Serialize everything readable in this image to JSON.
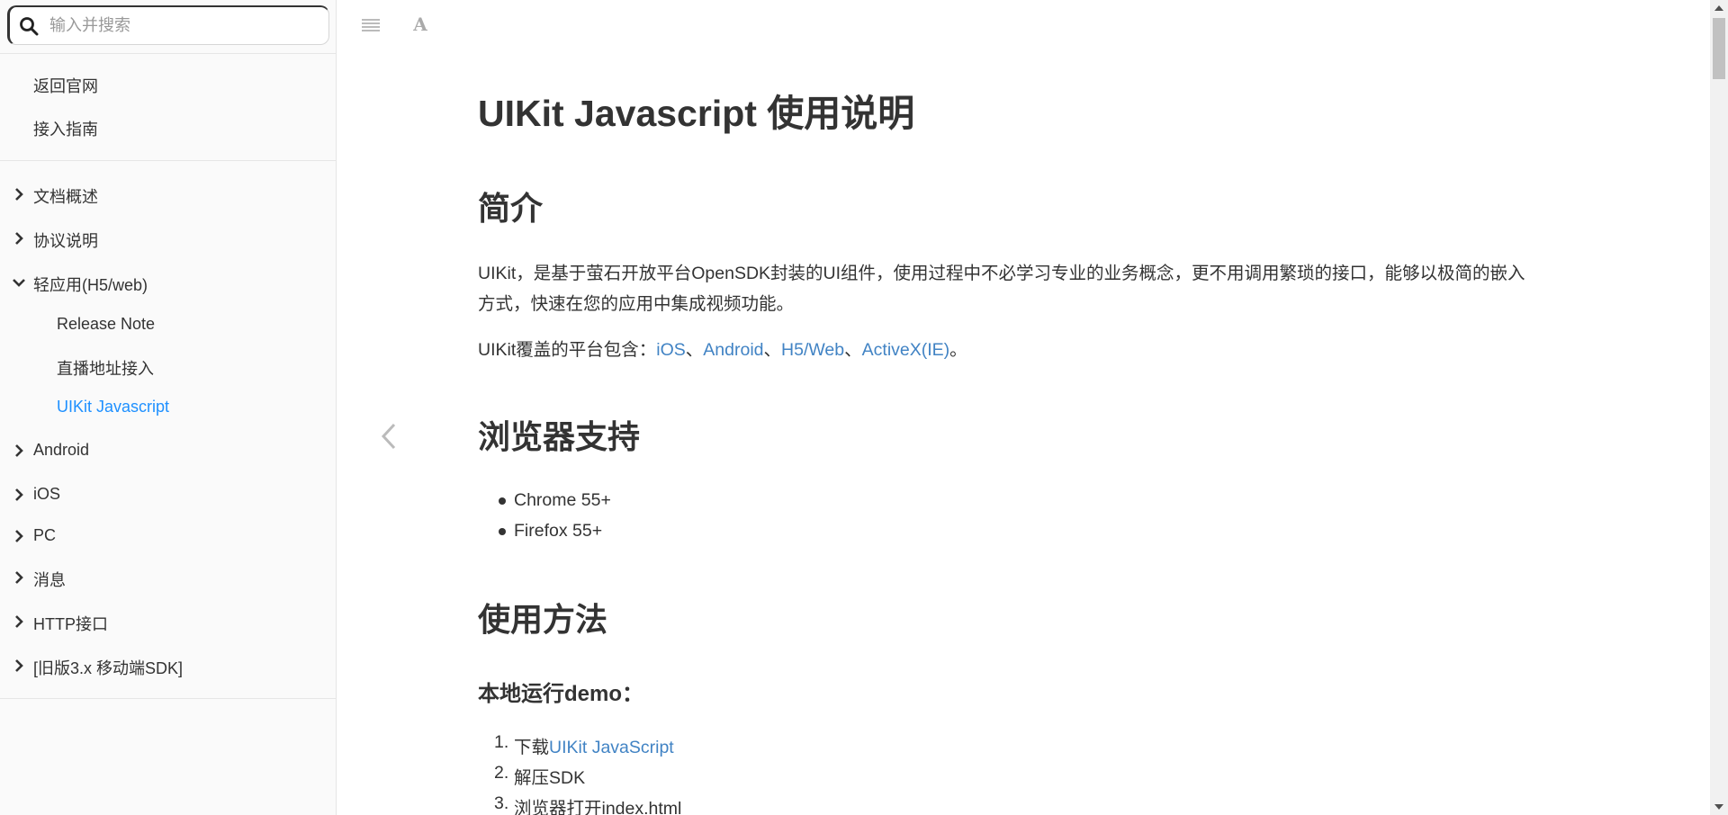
{
  "search": {
    "placeholder": "输入并搜索"
  },
  "sidebar": {
    "top_items": [
      {
        "label": "返回官网"
      },
      {
        "label": "接入指南"
      }
    ],
    "items": [
      {
        "label": "文档概述",
        "state": "collapsed"
      },
      {
        "label": "协议说明",
        "state": "collapsed"
      },
      {
        "label": "轻应用(H5/web)",
        "state": "expanded"
      },
      {
        "label": "Release Note",
        "level": 2
      },
      {
        "label": "直播地址接入",
        "level": 2
      },
      {
        "label": "UIKit Javascript",
        "level": 2,
        "active": true
      },
      {
        "label": "Android",
        "state": "collapsed"
      },
      {
        "label": "iOS",
        "state": "collapsed"
      },
      {
        "label": "PC",
        "state": "collapsed"
      },
      {
        "label": "消息",
        "state": "collapsed"
      },
      {
        "label": "HTTP接口",
        "state": "collapsed"
      },
      {
        "label": "[旧版3.x 移动端SDK]",
        "state": "collapsed"
      }
    ]
  },
  "toolbar": {
    "menu_icon": "hamburger-icon",
    "font_icon": "font-settings-icon",
    "font_glyph": "A"
  },
  "colors": {
    "link": "#4183c4",
    "active": "#1e90ff",
    "text": "#333333"
  },
  "content": {
    "title": "UIKit Javascript 使用说明",
    "intro": {
      "heading": "简介",
      "para1_line1": "UIKit，是基于萤石开放平台OpenSDK封装的UI组件，使用过程中不必学习专业的业务概念，更不用调用繁琐的接口，能够以极简的嵌入",
      "para1_line2": "方式，快速在您的应用中集成视频功能。",
      "para2_prefix": "UIKit覆盖的平台包含：",
      "platforms": [
        "iOS",
        "Android",
        "H5/Web",
        "ActiveX(IE)"
      ],
      "sep": "、",
      "para2_suffix": "。"
    },
    "browsers": {
      "heading": "浏览器支持",
      "items": [
        "Chrome 55+",
        "Firefox 55+"
      ]
    },
    "usage": {
      "heading": "使用方法",
      "subheading": "本地运行demo：",
      "steps": [
        {
          "num": "1.",
          "text": "下载",
          "link": "UIKit JavaScript"
        },
        {
          "num": "2.",
          "text": "解压SDK"
        },
        {
          "num": "3.",
          "text": "浏览器打开index.html"
        }
      ]
    }
  }
}
